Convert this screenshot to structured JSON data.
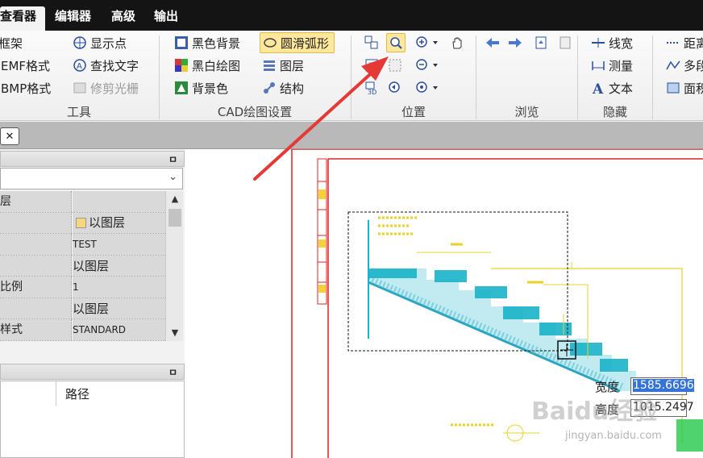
{
  "menu": {
    "tabs": [
      {
        "label": "查看器",
        "active": true
      },
      {
        "label": "编辑器"
      },
      {
        "label": "高级"
      },
      {
        "label": "输出"
      }
    ]
  },
  "ribbon": {
    "tools": {
      "items": [
        "框架",
        "到EMF格式",
        "到BMP格式"
      ],
      "items_right": [
        "显示点",
        "查找文字",
        "修剪光栅"
      ],
      "label": "工具"
    },
    "cad": {
      "items": [
        "黑色背景",
        "黑白绘图",
        "背景色"
      ],
      "items_right": [
        "圆滑弧形",
        "图层",
        "结构"
      ],
      "label": "CAD绘图设置"
    },
    "position": {
      "label": "位置"
    },
    "browse": {
      "label": "浏览"
    },
    "hidden": {
      "items": [
        "线宽",
        "测量",
        "文本"
      ],
      "label": "隐藏"
    },
    "measure_partial": {
      "items": [
        "距离",
        "多段",
        "面积"
      ]
    }
  },
  "docstrip": {
    "close_symbol": "✕"
  },
  "properties": {
    "pin": "ㅁ",
    "rows": [
      {
        "name": "层",
        "value": ""
      },
      {
        "name": "",
        "value": "以图层",
        "swatch": "#f7d77a"
      },
      {
        "name": "",
        "value": "TEST"
      },
      {
        "name": "",
        "value": "以图层"
      },
      {
        "name": "比例",
        "value": "1"
      },
      {
        "name": "",
        "value": "以图层"
      },
      {
        "name": "样式",
        "value": "STANDARD"
      }
    ]
  },
  "files": {
    "pin": "ㅁ",
    "col_path": "路径"
  },
  "measure": {
    "width_label": "宽度",
    "width_value": "1585.6696",
    "height_label": "高度",
    "height_value": "1015.2497"
  },
  "watermark": {
    "brand": "Baidu经验",
    "url": "jingyan.baidu.com"
  },
  "colors": {
    "accent_red": "#e53935",
    "cad_cyan": "#1ab3c9",
    "cad_yellow": "#e8d22a",
    "cad_red": "#e02020"
  }
}
